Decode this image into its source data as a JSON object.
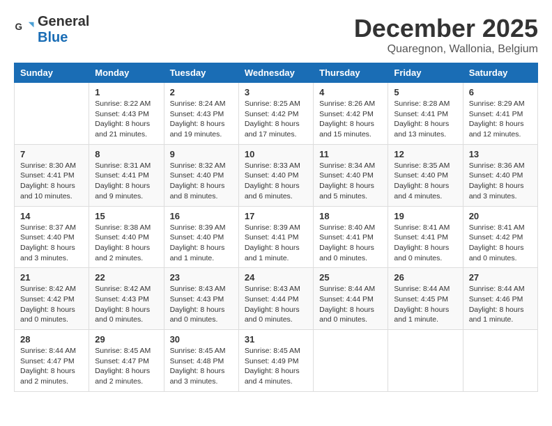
{
  "header": {
    "logo": {
      "general": "General",
      "blue": "Blue"
    },
    "title": "December 2025",
    "subtitle": "Quaregnon, Wallonia, Belgium"
  },
  "calendar": {
    "days_of_week": [
      "Sunday",
      "Monday",
      "Tuesday",
      "Wednesday",
      "Thursday",
      "Friday",
      "Saturday"
    ],
    "weeks": [
      [
        {
          "day": "",
          "info": ""
        },
        {
          "day": "1",
          "info": "Sunrise: 8:22 AM\nSunset: 4:43 PM\nDaylight: 8 hours\nand 21 minutes."
        },
        {
          "day": "2",
          "info": "Sunrise: 8:24 AM\nSunset: 4:43 PM\nDaylight: 8 hours\nand 19 minutes."
        },
        {
          "day": "3",
          "info": "Sunrise: 8:25 AM\nSunset: 4:42 PM\nDaylight: 8 hours\nand 17 minutes."
        },
        {
          "day": "4",
          "info": "Sunrise: 8:26 AM\nSunset: 4:42 PM\nDaylight: 8 hours\nand 15 minutes."
        },
        {
          "day": "5",
          "info": "Sunrise: 8:28 AM\nSunset: 4:41 PM\nDaylight: 8 hours\nand 13 minutes."
        },
        {
          "day": "6",
          "info": "Sunrise: 8:29 AM\nSunset: 4:41 PM\nDaylight: 8 hours\nand 12 minutes."
        }
      ],
      [
        {
          "day": "7",
          "info": "Sunrise: 8:30 AM\nSunset: 4:41 PM\nDaylight: 8 hours\nand 10 minutes."
        },
        {
          "day": "8",
          "info": "Sunrise: 8:31 AM\nSunset: 4:41 PM\nDaylight: 8 hours\nand 9 minutes."
        },
        {
          "day": "9",
          "info": "Sunrise: 8:32 AM\nSunset: 4:40 PM\nDaylight: 8 hours\nand 8 minutes."
        },
        {
          "day": "10",
          "info": "Sunrise: 8:33 AM\nSunset: 4:40 PM\nDaylight: 8 hours\nand 6 minutes."
        },
        {
          "day": "11",
          "info": "Sunrise: 8:34 AM\nSunset: 4:40 PM\nDaylight: 8 hours\nand 5 minutes."
        },
        {
          "day": "12",
          "info": "Sunrise: 8:35 AM\nSunset: 4:40 PM\nDaylight: 8 hours\nand 4 minutes."
        },
        {
          "day": "13",
          "info": "Sunrise: 8:36 AM\nSunset: 4:40 PM\nDaylight: 8 hours\nand 3 minutes."
        }
      ],
      [
        {
          "day": "14",
          "info": "Sunrise: 8:37 AM\nSunset: 4:40 PM\nDaylight: 8 hours\nand 3 minutes."
        },
        {
          "day": "15",
          "info": "Sunrise: 8:38 AM\nSunset: 4:40 PM\nDaylight: 8 hours\nand 2 minutes."
        },
        {
          "day": "16",
          "info": "Sunrise: 8:39 AM\nSunset: 4:40 PM\nDaylight: 8 hours\nand 1 minute."
        },
        {
          "day": "17",
          "info": "Sunrise: 8:39 AM\nSunset: 4:41 PM\nDaylight: 8 hours\nand 1 minute."
        },
        {
          "day": "18",
          "info": "Sunrise: 8:40 AM\nSunset: 4:41 PM\nDaylight: 8 hours\nand 0 minutes."
        },
        {
          "day": "19",
          "info": "Sunrise: 8:41 AM\nSunset: 4:41 PM\nDaylight: 8 hours\nand 0 minutes."
        },
        {
          "day": "20",
          "info": "Sunrise: 8:41 AM\nSunset: 4:42 PM\nDaylight: 8 hours\nand 0 minutes."
        }
      ],
      [
        {
          "day": "21",
          "info": "Sunrise: 8:42 AM\nSunset: 4:42 PM\nDaylight: 8 hours\nand 0 minutes."
        },
        {
          "day": "22",
          "info": "Sunrise: 8:42 AM\nSunset: 4:43 PM\nDaylight: 8 hours\nand 0 minutes."
        },
        {
          "day": "23",
          "info": "Sunrise: 8:43 AM\nSunset: 4:43 PM\nDaylight: 8 hours\nand 0 minutes."
        },
        {
          "day": "24",
          "info": "Sunrise: 8:43 AM\nSunset: 4:44 PM\nDaylight: 8 hours\nand 0 minutes."
        },
        {
          "day": "25",
          "info": "Sunrise: 8:44 AM\nSunset: 4:44 PM\nDaylight: 8 hours\nand 0 minutes."
        },
        {
          "day": "26",
          "info": "Sunrise: 8:44 AM\nSunset: 4:45 PM\nDaylight: 8 hours\nand 1 minute."
        },
        {
          "day": "27",
          "info": "Sunrise: 8:44 AM\nSunset: 4:46 PM\nDaylight: 8 hours\nand 1 minute."
        }
      ],
      [
        {
          "day": "28",
          "info": "Sunrise: 8:44 AM\nSunset: 4:47 PM\nDaylight: 8 hours\nand 2 minutes."
        },
        {
          "day": "29",
          "info": "Sunrise: 8:45 AM\nSunset: 4:47 PM\nDaylight: 8 hours\nand 2 minutes."
        },
        {
          "day": "30",
          "info": "Sunrise: 8:45 AM\nSunset: 4:48 PM\nDaylight: 8 hours\nand 3 minutes."
        },
        {
          "day": "31",
          "info": "Sunrise: 8:45 AM\nSunset: 4:49 PM\nDaylight: 8 hours\nand 4 minutes."
        },
        {
          "day": "",
          "info": ""
        },
        {
          "day": "",
          "info": ""
        },
        {
          "day": "",
          "info": ""
        }
      ]
    ]
  }
}
